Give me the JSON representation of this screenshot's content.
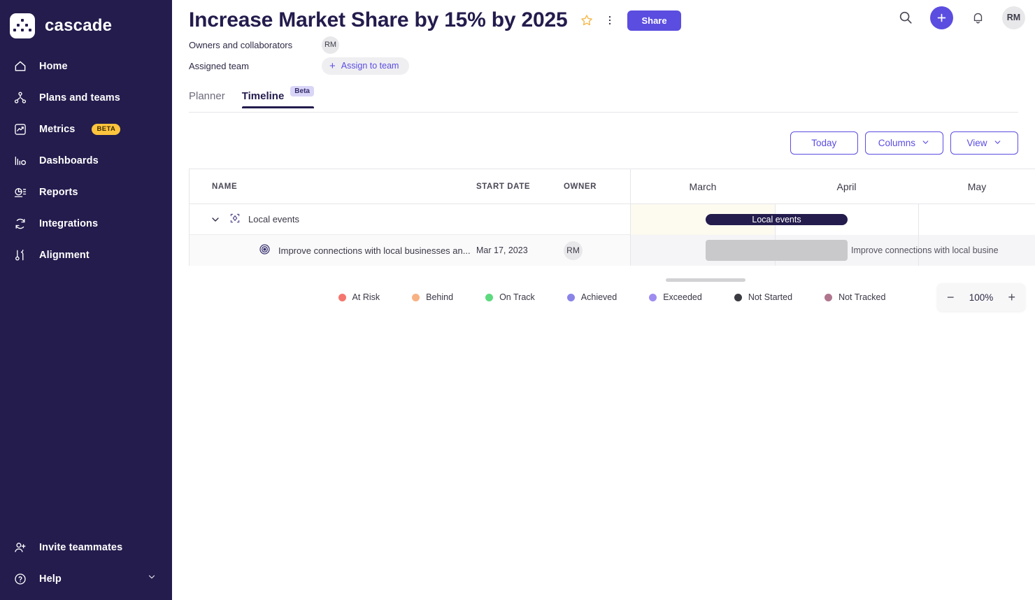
{
  "brand": {
    "name": "cascade",
    "logo_icon": "cascade-dots-logo"
  },
  "sidebar": {
    "items": [
      {
        "label": "Home",
        "icon": "home-icon"
      },
      {
        "label": "Plans and teams",
        "icon": "plans-teams-icon"
      },
      {
        "label": "Metrics",
        "icon": "metrics-chart-icon",
        "badge": "BETA"
      },
      {
        "label": "Dashboards",
        "icon": "dashboards-bars-icon"
      },
      {
        "label": "Reports",
        "icon": "reports-pie-icon"
      },
      {
        "label": "Integrations",
        "icon": "integrations-sync-icon"
      },
      {
        "label": "Alignment",
        "icon": "alignment-icon"
      }
    ],
    "bottom": [
      {
        "label": "Invite teammates",
        "icon": "user-plus-icon"
      },
      {
        "label": "Help",
        "icon": "question-circle-icon",
        "chevron": "chevron-down-icon"
      }
    ]
  },
  "topbar": {
    "search_icon": "search-icon",
    "add_icon": "plus-icon",
    "notifications_icon": "bell-icon",
    "avatar_initials": "RM"
  },
  "header": {
    "title": "Increase Market Share by 15% by 2025",
    "star_icon": "star-outline-icon",
    "more_icon": "kebab-menu-icon",
    "share_label": "Share",
    "owners_label": "Owners and collaborators",
    "owner_initials": "RM",
    "team_label": "Assigned team",
    "assign_plus": "+",
    "assign_label": "Assign to team"
  },
  "tabs": [
    {
      "label": "Planner",
      "active": false
    },
    {
      "label": "Timeline",
      "active": true,
      "badge": "Beta"
    }
  ],
  "toolbar": {
    "today_label": "Today",
    "columns_label": "Columns",
    "view_label": "View",
    "chevron_icon": "chevron-down-icon"
  },
  "table": {
    "columns": [
      "NAME",
      "START DATE",
      "OWNER"
    ],
    "rows": [
      {
        "name": "Local events",
        "icon": "focus-area-icon",
        "type": "parent",
        "start_date": "",
        "owner": "",
        "caret": "chevron-down-icon"
      },
      {
        "name": "Improve connections with local businesses an...",
        "icon": "objective-target-icon",
        "type": "child",
        "start_date": "Mar 17, 2023",
        "owner": "RM"
      }
    ]
  },
  "timeline": {
    "months": [
      "March",
      "April",
      "May"
    ],
    "bars": [
      {
        "label": "Local events",
        "type": "parent",
        "label_inside": true
      },
      {
        "label": "Improve connections with local busine",
        "type": "child",
        "label_inside": false
      }
    ]
  },
  "legend": [
    {
      "label": "At Risk",
      "color": "#F4766E"
    },
    {
      "label": "Behind",
      "color": "#F8B183"
    },
    {
      "label": "On Track",
      "color": "#5DD97E"
    },
    {
      "label": "Achieved",
      "color": "#8A84E8"
    },
    {
      "label": "Exceeded",
      "color": "#9E8CF0"
    },
    {
      "label": "Not Started",
      "color": "#3B3B42"
    },
    {
      "label": "Not Tracked",
      "color": "#B0768E"
    }
  ],
  "zoom_control": {
    "minus": "−",
    "value": "100%",
    "plus": "+"
  },
  "colors": {
    "sidebar_bg": "#231C4D",
    "accent": "#5B4DE0",
    "beta_badge": "#FFC43D",
    "bar_parent": "#231C4D",
    "bar_child": "#C9C9CC",
    "today_band": "#FDFAF0"
  }
}
